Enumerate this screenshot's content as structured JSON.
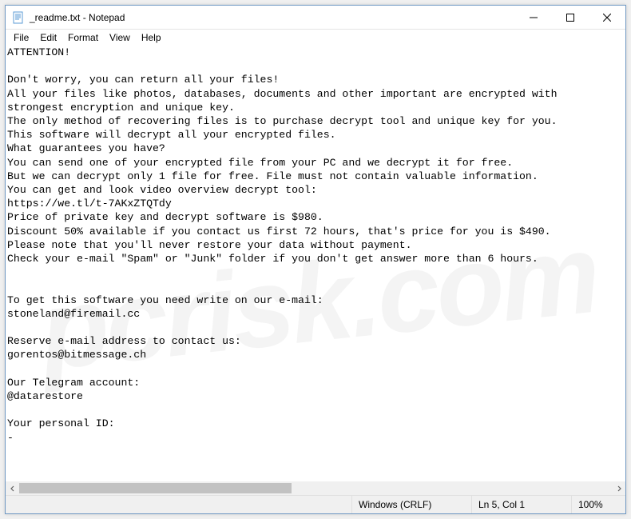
{
  "window": {
    "title": "_readme.txt - Notepad"
  },
  "menu": {
    "file": "File",
    "edit": "Edit",
    "format": "Format",
    "view": "View",
    "help": "Help"
  },
  "document": {
    "text": "ATTENTION!\n\nDon't worry, you can return all your files!\nAll your files like photos, databases, documents and other important are encrypted with \nstrongest encryption and unique key.\nThe only method of recovering files is to purchase decrypt tool and unique key for you.\nThis software will decrypt all your encrypted files.\nWhat guarantees you have?\nYou can send one of your encrypted file from your PC and we decrypt it for free.\nBut we can decrypt only 1 file for free. File must not contain valuable information.\nYou can get and look video overview decrypt tool:\nhttps://we.tl/t-7AKxZTQTdy\nPrice of private key and decrypt software is $980.\nDiscount 50% available if you contact us first 72 hours, that's price for you is $490.\nPlease note that you'll never restore your data without payment.\nCheck your e-mail \"Spam\" or \"Junk\" folder if you don't get answer more than 6 hours.\n\n\nTo get this software you need write on our e-mail:\nstoneland@firemail.cc\n\nReserve e-mail address to contact us:\ngorentos@bitmessage.ch\n\nOur Telegram account:\n@datarestore\n\nYour personal ID:\n-"
  },
  "status": {
    "encoding": "Windows (CRLF)",
    "position": "Ln 5, Col 1",
    "zoom": "100%"
  },
  "watermark": {
    "text": "pcrisk.com"
  }
}
